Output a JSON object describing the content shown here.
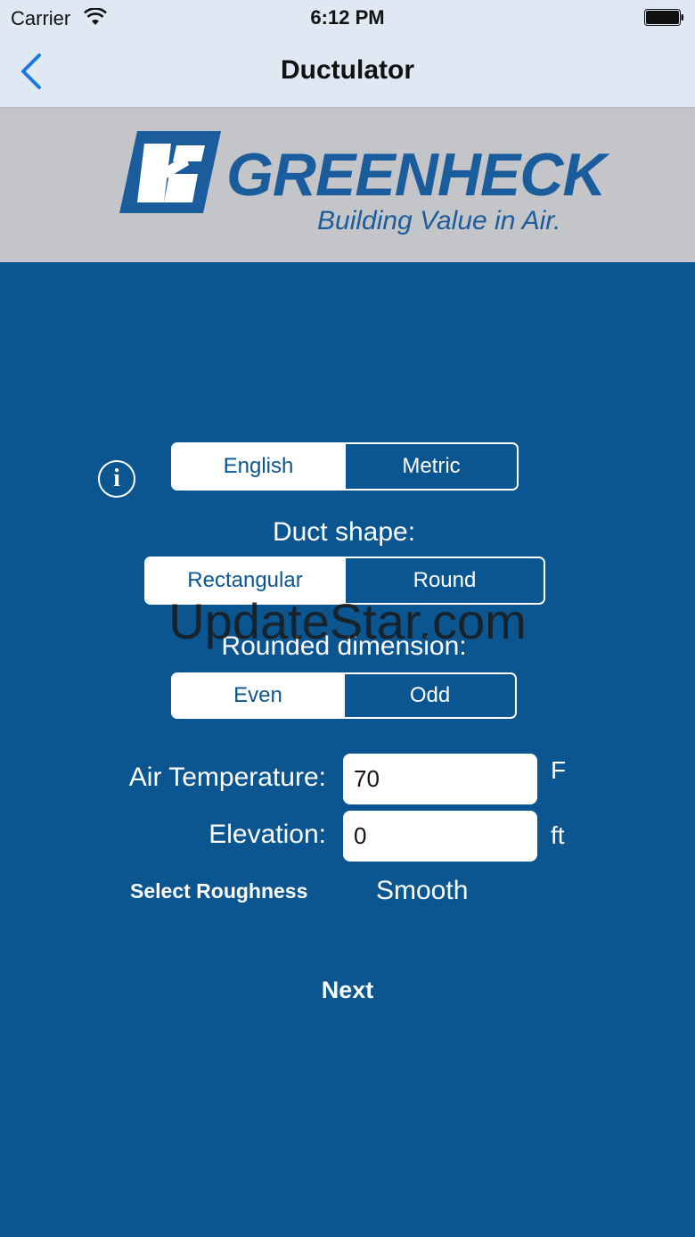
{
  "status_bar": {
    "carrier": "Carrier",
    "time": "6:12 PM"
  },
  "nav": {
    "title": "Ductulator"
  },
  "banner": {
    "brand": "GREENHECK",
    "tagline": "Building Value in Air."
  },
  "units": {
    "options": [
      "English",
      "Metric"
    ],
    "selected": "English"
  },
  "duct_shape": {
    "label": "Duct shape:",
    "options": [
      "Rectangular",
      "Round"
    ],
    "selected": "Rectangular"
  },
  "rounded_dimension": {
    "label": "Rounded dimension:",
    "options": [
      "Even",
      "Odd"
    ],
    "selected": "Even"
  },
  "air_temperature": {
    "label": "Air Temperature:",
    "value": "70",
    "unit": "F"
  },
  "elevation": {
    "label": "Elevation:",
    "value": "0",
    "unit": "ft"
  },
  "roughness": {
    "label": "Select Roughness",
    "value": "Smooth"
  },
  "next_label": "Next",
  "watermark": "UpdateStar.com",
  "colors": {
    "background": "#0b5690",
    "nav_bar": "#dfe8f3",
    "banner": "#c4c5c8",
    "accent": "#1a7ae0",
    "brand": "#1b5c9d"
  }
}
